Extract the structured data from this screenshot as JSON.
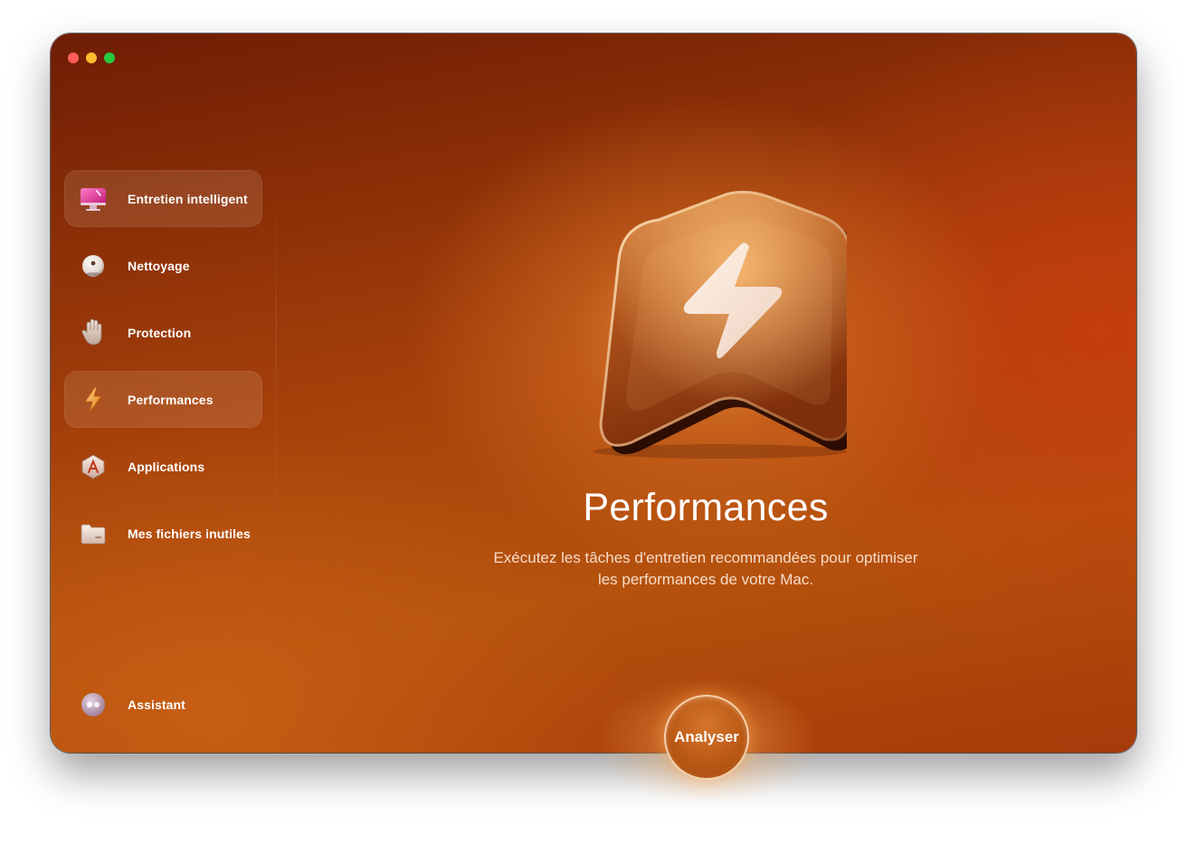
{
  "window": {
    "traffic_lights": [
      "close",
      "minimize",
      "maximize"
    ]
  },
  "sidebar": {
    "items": [
      {
        "label": "Entretien intelligent",
        "icon": "monitor-icon",
        "selected": true
      },
      {
        "label": "Nettoyage",
        "icon": "cleaning-disc-icon",
        "selected": false
      },
      {
        "label": "Protection",
        "icon": "hand-icon",
        "selected": false
      },
      {
        "label": "Performances",
        "icon": "lightning-icon",
        "selected": true
      },
      {
        "label": "Applications",
        "icon": "applications-icon",
        "selected": false
      },
      {
        "label": "Mes fichiers inutiles",
        "icon": "folder-icon",
        "selected": false
      }
    ],
    "assistant": {
      "label": "Assistant",
      "icon": "assistant-icon"
    }
  },
  "main": {
    "hero_icon": "performance-lightning-icon",
    "title": "Performances",
    "description_line1": "Exécutez les tâches d'entretien recommandées pour optimiser",
    "description_line2": "les performances de votre Mac."
  },
  "scan_button": {
    "label": "Analyser"
  },
  "colors": {
    "accent": "#b5520d",
    "background_dark": "#6e1d05",
    "text": "#ffffff"
  }
}
